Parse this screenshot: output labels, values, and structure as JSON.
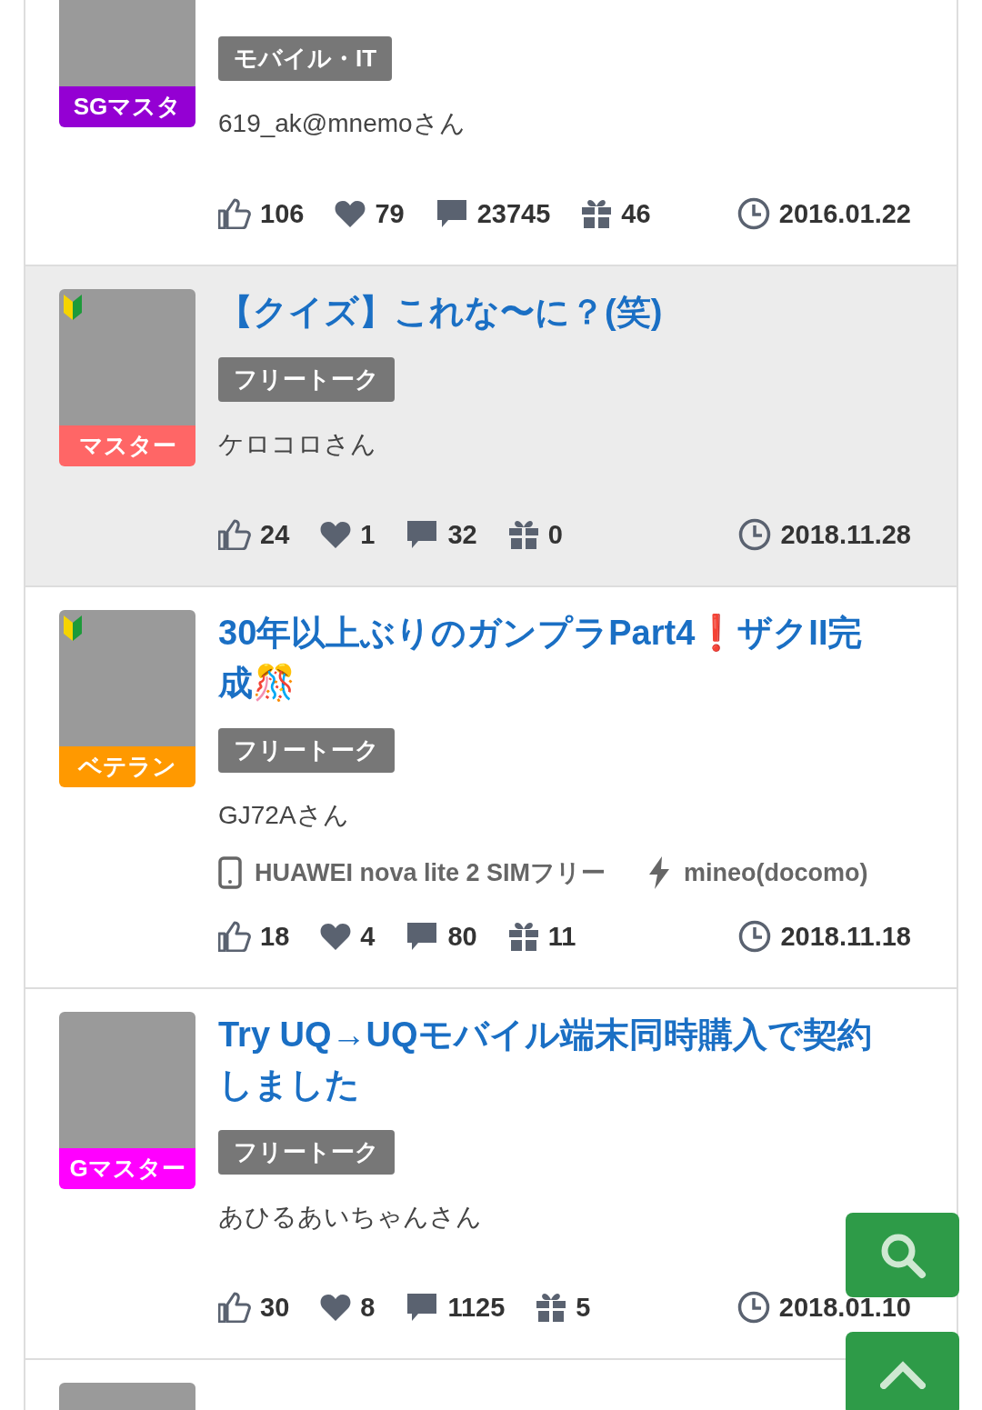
{
  "posts": [
    {
      "highlighted": false,
      "badge": {
        "label": "SGマスタ",
        "color": "#9400d3"
      },
      "beginner": false,
      "category": "モバイル・IT",
      "author": "619_ak@mnemoさん",
      "stats": {
        "likes": "106",
        "hearts": "79",
        "comments": "23745",
        "gifts": "46"
      },
      "date": "2016.01.22"
    },
    {
      "highlighted": true,
      "badge": {
        "label": "マスター",
        "color": "#ff6666"
      },
      "beginner": true,
      "title": "【クイズ】これな〜に？(笑)",
      "category": "フリートーク",
      "author": "ケロコロさん",
      "stats": {
        "likes": "24",
        "hearts": "1",
        "comments": "32",
        "gifts": "0"
      },
      "date": "2018.11.28"
    },
    {
      "highlighted": false,
      "badge": {
        "label": "ベテラン",
        "color": "#ff9900"
      },
      "beginner": true,
      "title": "30年以上ぶりのガンプラPart4❗ザクII完成🎊",
      "category": "フリートーク",
      "author": "GJ72Aさん",
      "device": "HUAWEI nova lite 2 SIMフリー",
      "carrier": "mineo(docomo)",
      "stats": {
        "likes": "18",
        "hearts": "4",
        "comments": "80",
        "gifts": "11"
      },
      "date": "2018.11.18"
    },
    {
      "highlighted": false,
      "badge": {
        "label": "Gマスター",
        "color": "#ff00ff"
      },
      "beginner": false,
      "title": "Try UQ→UQモバイル端末同時購入で契約しました",
      "category": "フリートーク",
      "author": "あひるあいちゃんさん",
      "stats": {
        "likes": "30",
        "hearts": "8",
        "comments": "1125",
        "gifts": "5"
      },
      "date": "2018.01.10"
    },
    {
      "highlighted": false
    }
  ]
}
